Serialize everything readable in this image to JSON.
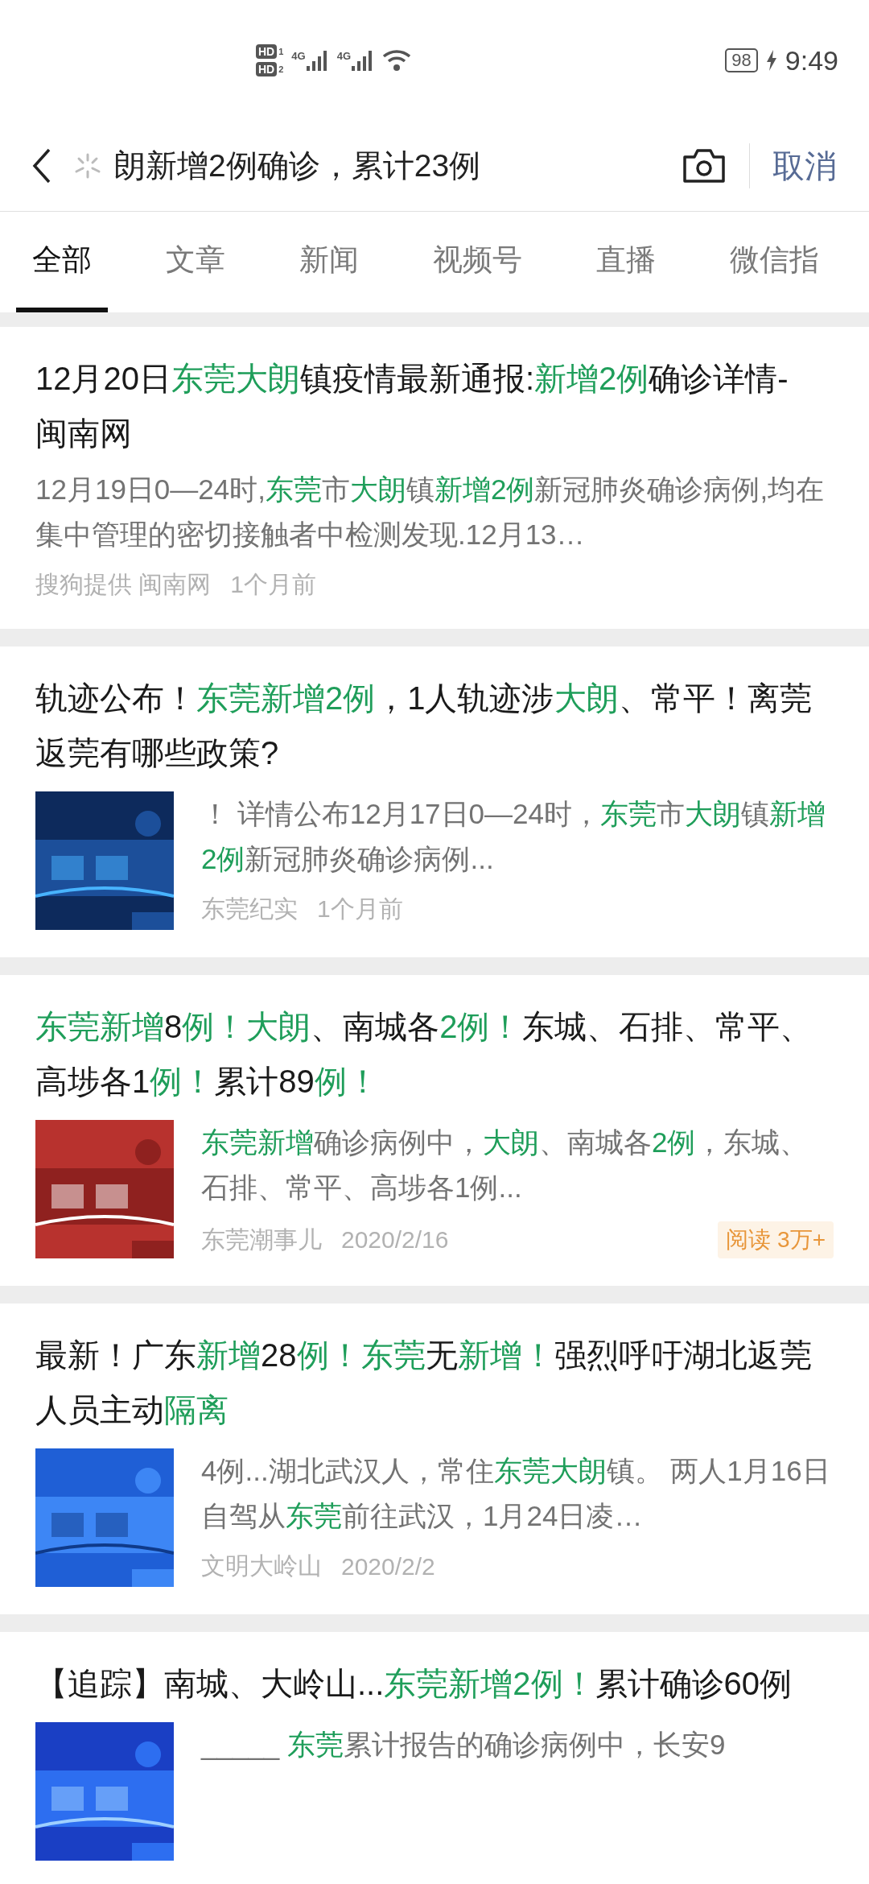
{
  "status_bar": {
    "sims": [
      {
        "label": "HD",
        "slot": "1"
      },
      {
        "label": "HD",
        "slot": "2"
      }
    ],
    "networks": [
      "4G",
      "4G"
    ],
    "battery": "98",
    "time": "9:49"
  },
  "search": {
    "value": "朗新增2例确诊，累计23例",
    "cancel": "取消"
  },
  "tabs": [
    {
      "label": "全部",
      "selected": true
    },
    {
      "label": "文章",
      "selected": false
    },
    {
      "label": "新闻",
      "selected": false
    },
    {
      "label": "视频号",
      "selected": false
    },
    {
      "label": "直播",
      "selected": false
    },
    {
      "label": "微信指",
      "selected": false
    }
  ],
  "results": [
    {
      "title": [
        {
          "text": "12月20日",
          "highlight": false
        },
        {
          "text": "东莞大朗",
          "highlight": true
        },
        {
          "text": "镇疫情最新通报:",
          "highlight": false
        },
        {
          "text": "新增2例",
          "highlight": true
        },
        {
          "text": "确诊详情-闽南网",
          "highlight": false
        }
      ],
      "snippet": [
        {
          "text": "12月19日0—24时,",
          "highlight": false
        },
        {
          "text": "东莞",
          "highlight": true
        },
        {
          "text": "市",
          "highlight": false
        },
        {
          "text": "大朗",
          "highlight": true
        },
        {
          "text": "镇",
          "highlight": false
        },
        {
          "text": "新增2例",
          "highlight": true
        },
        {
          "text": "新冠肺炎确诊病例,均在集中管理的密切接触者中检测发现.12月13…",
          "highlight": false
        }
      ],
      "meta": [
        "搜狗提供 闽南网",
        "1个月前"
      ]
    },
    {
      "title": [
        {
          "text": "轨迹公布！",
          "highlight": false
        },
        {
          "text": "东莞新增2例",
          "highlight": true
        },
        {
          "text": "，1人轨迹涉",
          "highlight": false
        },
        {
          "text": "大朗",
          "highlight": true
        },
        {
          "text": "、常平！离莞返莞有哪些政策?",
          "highlight": false
        }
      ],
      "thumbnail": {
        "kind": "picture"
      },
      "snippet": [
        {
          "text": "！ 详情公布12月17日0—24时，",
          "highlight": false
        },
        {
          "text": "东莞",
          "highlight": true
        },
        {
          "text": "市",
          "highlight": false
        },
        {
          "text": "大朗",
          "highlight": true
        },
        {
          "text": "镇",
          "highlight": false
        },
        {
          "text": "新增2例",
          "highlight": true
        },
        {
          "text": "新冠肺炎确诊病例...",
          "highlight": false
        }
      ],
      "meta": [
        "东莞纪实",
        "1个月前"
      ]
    },
    {
      "title": [
        {
          "text": "东莞新增",
          "highlight": true
        },
        {
          "text": "8",
          "highlight": false
        },
        {
          "text": "例！",
          "highlight": true
        },
        {
          "text": "大朗",
          "highlight": true
        },
        {
          "text": "、南城各",
          "highlight": false
        },
        {
          "text": "2例！",
          "highlight": true
        },
        {
          "text": "东城、石排、常平、高埗各1",
          "highlight": false
        },
        {
          "text": "例！",
          "highlight": true
        },
        {
          "text": "累计89",
          "highlight": false
        },
        {
          "text": "例！",
          "highlight": true
        }
      ],
      "thumbnail": {
        "kind": "picture"
      },
      "snippet": [
        {
          "text": "东莞新增",
          "highlight": true
        },
        {
          "text": "确诊病例中，",
          "highlight": false
        },
        {
          "text": "大朗",
          "highlight": true
        },
        {
          "text": "、南城各",
          "highlight": false
        },
        {
          "text": "2例",
          "highlight": true
        },
        {
          "text": "，东城、石排、常平、高埗各1例...",
          "highlight": false
        }
      ],
      "meta": [
        "东莞潮事儿",
        "2020/2/16"
      ],
      "reads": "阅读 3万+"
    },
    {
      "title": [
        {
          "text": "最新！广东",
          "highlight": false
        },
        {
          "text": "新增",
          "highlight": true
        },
        {
          "text": "28",
          "highlight": false
        },
        {
          "text": "例！",
          "highlight": true
        },
        {
          "text": "东莞",
          "highlight": true
        },
        {
          "text": "无",
          "highlight": false
        },
        {
          "text": "新增！",
          "highlight": true
        },
        {
          "text": "强烈呼吁湖北返莞人员主动",
          "highlight": false
        },
        {
          "text": "隔离",
          "highlight": true
        }
      ],
      "thumbnail": {
        "kind": "picture"
      },
      "snippet": [
        {
          "text": "4例...湖北武汉人，常住",
          "highlight": false
        },
        {
          "text": "东莞大朗",
          "highlight": true
        },
        {
          "text": "镇。 两人1月16日自驾从",
          "highlight": false
        },
        {
          "text": "东莞",
          "highlight": true
        },
        {
          "text": "前往武汉，1月24日凌…",
          "highlight": false
        }
      ],
      "meta": [
        "文明大岭山",
        "2020/2/2"
      ]
    },
    {
      "title": [
        {
          "text": "【追踪】南城、大岭山...",
          "highlight": false
        },
        {
          "text": "东莞新增2例！",
          "highlight": true
        },
        {
          "text": "累计确诊60例",
          "highlight": false
        }
      ],
      "thumbnail": {
        "kind": "picture"
      },
      "snippet": [
        {
          "text": "_____ ",
          "highlight": false
        },
        {
          "text": "东莞",
          "highlight": true
        },
        {
          "text": "累计报告的确诊病例中，长安9",
          "highlight": false
        }
      ]
    }
  ]
}
